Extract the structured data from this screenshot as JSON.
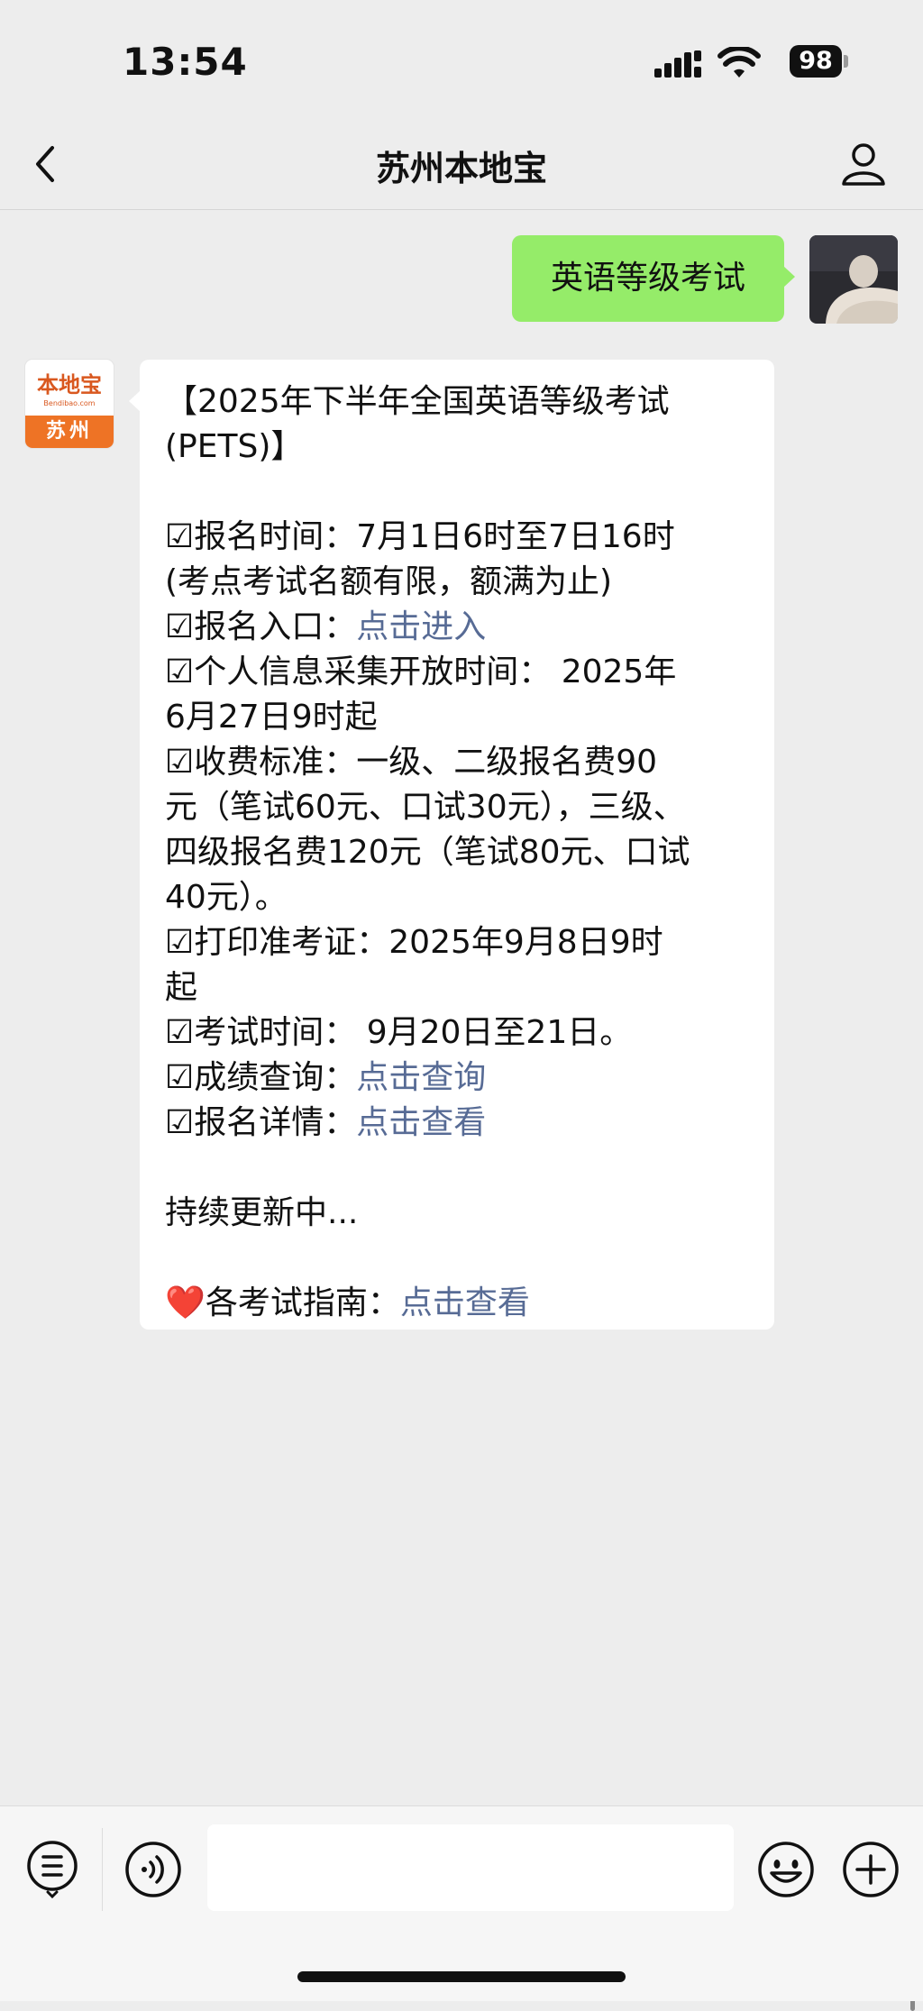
{
  "status_bar": {
    "time": "13:54",
    "battery": "98"
  },
  "nav": {
    "title": "苏州本地宝"
  },
  "messages": {
    "sent_text": "英语等级考试",
    "bot_logo_text": "本地宝",
    "bot_logo_url": "Bendibao.com",
    "bot_logo_city": "苏州",
    "lines": [
      {
        "text": "【2025年下半年全国英语等级考试"
      },
      {
        "text": "(PETS)】"
      },
      {
        "text": ""
      },
      {
        "text": "☑报名时间：7月1日6时至7日16时"
      },
      {
        "text": "(考点考试名额有限，额满为止)"
      },
      {
        "text": "☑报名入口：",
        "link": "点击进入"
      },
      {
        "text": "☑个人信息采集开放时间： 2025年"
      },
      {
        "text": "6月27日9时起"
      },
      {
        "text": "☑收费标准：一级、二级报名费90"
      },
      {
        "text": "元（笔试60元、口试30元），三级、"
      },
      {
        "text": "四级报名费120元（笔试80元、口试"
      },
      {
        "text": "40元）。"
      },
      {
        "text": "☑打印准考证：2025年9月8日9时"
      },
      {
        "text": "起"
      },
      {
        "text": "☑考试时间： 9月20日至21日。"
      },
      {
        "text": "☑成绩查询：",
        "link": "点击查询"
      },
      {
        "text": "☑报名详情：",
        "link": "点击查看"
      },
      {
        "text": ""
      },
      {
        "text": "持续更新中..."
      },
      {
        "text": ""
      },
      {
        "text": "各考试指南：",
        "link": "点击查看",
        "icon": "❤️"
      }
    ]
  },
  "input": {
    "placeholder": ""
  },
  "colors": {
    "sent_bubble": "#95ec69",
    "link": "#576b95",
    "background": "#ededed"
  }
}
